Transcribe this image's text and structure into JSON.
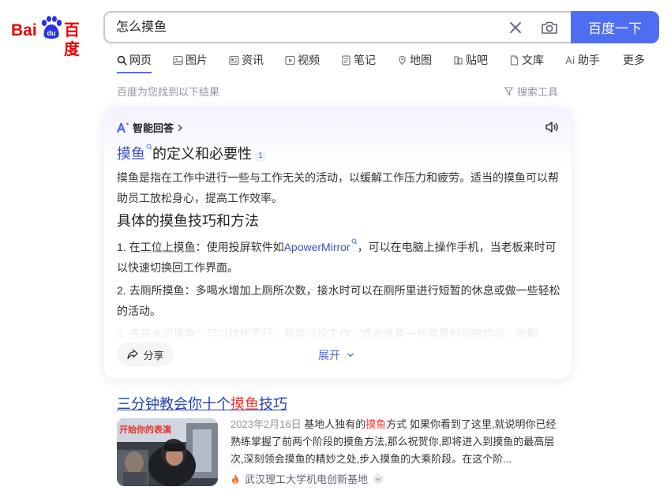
{
  "logo": {
    "text_left": "Bai",
    "text_mid": "du",
    "text_right": "百度"
  },
  "search": {
    "query": "怎么摸鱼",
    "button_label": "百度一下"
  },
  "tabs": [
    {
      "label": "网页",
      "icon": "search-icon",
      "active": true
    },
    {
      "label": "图片",
      "icon": "image-icon"
    },
    {
      "label": "资讯",
      "icon": "news-icon"
    },
    {
      "label": "视频",
      "icon": "video-icon"
    },
    {
      "label": "笔记",
      "icon": "note-icon"
    },
    {
      "label": "地图",
      "icon": "map-icon"
    },
    {
      "label": "贴吧",
      "icon": "tieba-icon"
    },
    {
      "label": "文库",
      "icon": "doc-icon"
    },
    {
      "label": "助手",
      "icon": "ai-icon"
    },
    {
      "label": "更多"
    }
  ],
  "result_count": "百度为您找到以下结果",
  "search_tools": "搜索工具",
  "ai_card": {
    "header": "智能回答",
    "heading1_kw": "摸鱼",
    "heading1_rest": "的定义和必要性",
    "cite1": "1",
    "para1": "摸鱼是指在工作中进行一些与工作无关的活动，以缓解工作压力和疲劳。适当的摸鱼可以帮助员工放松身心，提高工作效率。",
    "heading2": "具体的摸鱼技巧和方法",
    "item1_num": "1. ",
    "item1_kw": "在工位上摸鱼",
    "item1_mid": "：使用投屏软件如",
    "item1_link": "ApowerMirror",
    "item1_rest": "，可以在电脑上操作手机，当老板来时可以快速切换回工作界面。",
    "item2_num": "2. ",
    "item2_kw": "去厕所摸鱼",
    "item2_rest": "：多喝水增加上厕所次数，接水时可以在厕所里进行短暂的休息或做一些轻松的活动。",
    "item3_faded": "3. 去茶水间摸鱼：可以结伴而行，假装讨论工作，或者准备一些需要时间的饮品，如胸",
    "share_label": "分享",
    "expand_label": "展开"
  },
  "result": {
    "title_pre": "三分钟教会你十个",
    "title_hl": "摸鱼",
    "title_post": "技巧",
    "thumb_caption": "开始你的表演",
    "date": "2023年2月16日",
    "abstract_pre": " 基地人独有的",
    "abstract_hl": "摸鱼",
    "abstract_rest": "方式 如果你看到了这里,就说明你已经熟练掌握了前两个阶段的摸鱼方法,那么祝贺你,即将进入到摸鱼的最高层次,深刻领会摸鱼的精妙之处,步入摸鱼的大乘阶段。在这个阶...",
    "source": "武汉理工大学机电创新基地"
  },
  "colors": {
    "accent": "#4e6ef2",
    "link": "#2440b3",
    "highlight": "#f73131",
    "logo_red": "#e10602",
    "logo_blue": "#2932e1"
  }
}
